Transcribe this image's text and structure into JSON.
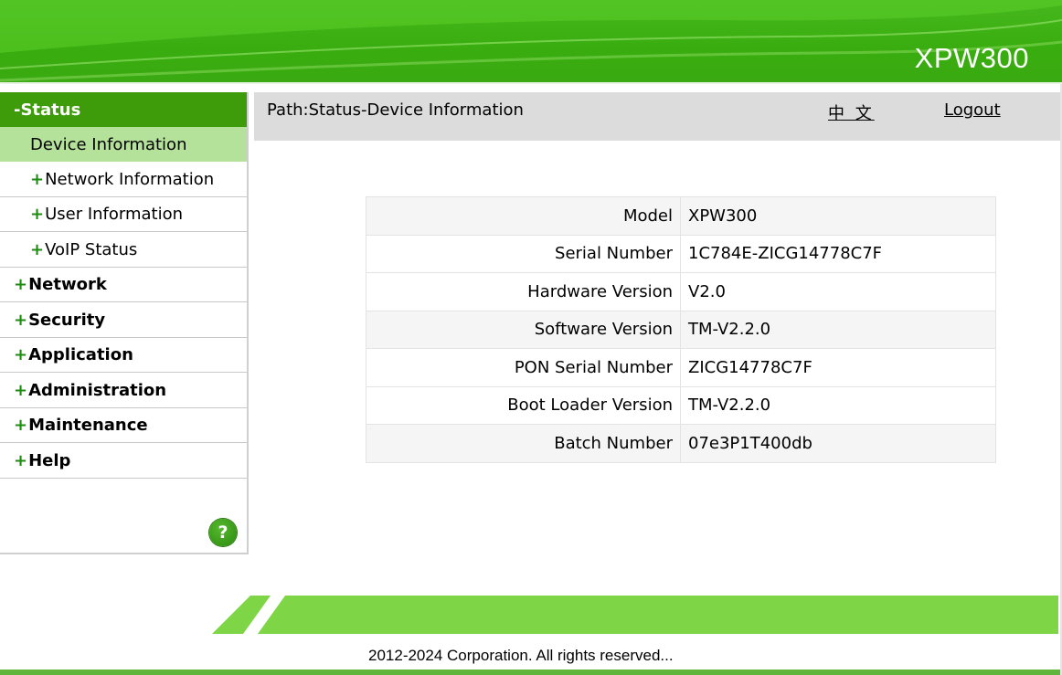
{
  "header": {
    "brand": "XPW300"
  },
  "sidebar": {
    "status": "-Status",
    "active_item": "Device Information",
    "sub_items": [
      {
        "label": "Network Information"
      },
      {
        "label": "User Information"
      },
      {
        "label": "VoIP Status"
      }
    ],
    "top_items": [
      {
        "label": "Network"
      },
      {
        "label": "Security"
      },
      {
        "label": "Application"
      },
      {
        "label": "Administration"
      },
      {
        "label": "Maintenance"
      },
      {
        "label": "Help"
      }
    ],
    "plus": "+",
    "help_glyph": "?"
  },
  "topbar": {
    "path": "Path:Status-Device Information",
    "lang": "中 文",
    "logout": "Logout"
  },
  "device": {
    "rows": [
      {
        "key": "Model",
        "value": "XPW300"
      },
      {
        "key": "Serial Number",
        "value": "1C784E-ZICG14778C7F"
      },
      {
        "key": "Hardware Version",
        "value": "V2.0"
      },
      {
        "key": "Software Version",
        "value": "TM-V2.2.0"
      },
      {
        "key": "PON Serial Number",
        "value": "ZICG14778C7F"
      },
      {
        "key": "Boot Loader Version",
        "value": "TM-V2.2.0"
      },
      {
        "key": "Batch Number",
        "value": "07e3P1T400db"
      }
    ]
  },
  "footer": {
    "copyright": "2012-2024 Corporation. All rights reserved..."
  },
  "colors": {
    "brand_green": "#3aad12",
    "light_green": "#7ed646",
    "active_bg": "#b5e29a"
  }
}
